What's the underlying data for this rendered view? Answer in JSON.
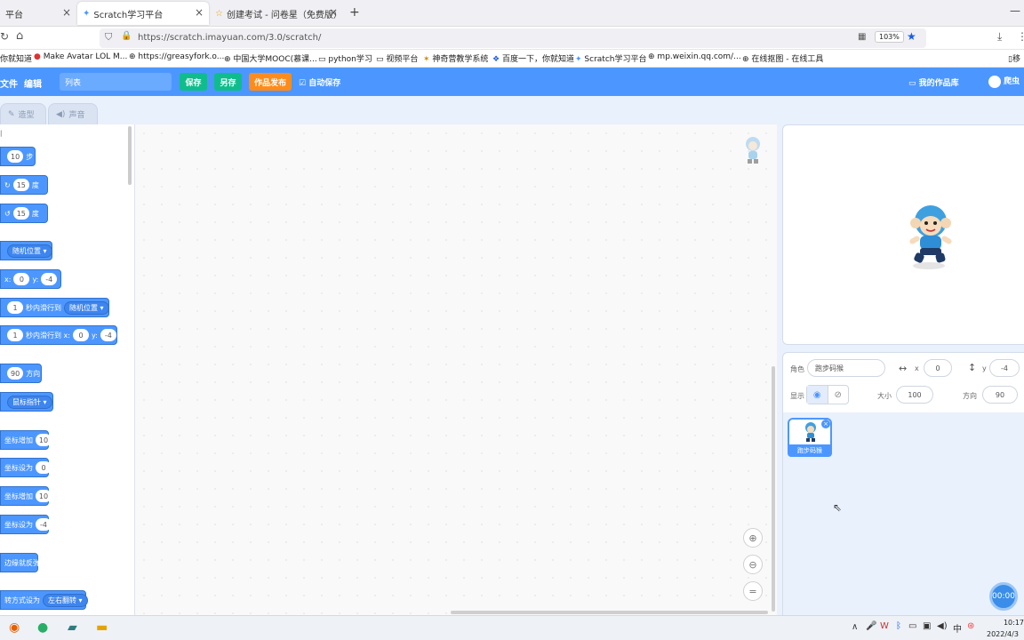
{
  "browser": {
    "tabs": [
      {
        "label": "平台"
      },
      {
        "label": "Scratch学习平台"
      },
      {
        "label": "创建考试 - 问卷星（免费版）"
      }
    ],
    "url": "https://scratch.imayuan.com/3.0/scratch/",
    "zoom": "103%",
    "bookmarks": [
      "你就知道",
      "Make Avatar LOL M...",
      "https://greasyfork.o...",
      "中国大学MOOC(慕课...",
      "python学习",
      "视频平台",
      "神奇营教学系统",
      "百度一下，你就知道",
      "Scratch学习平台",
      "mp.weixin.qq.com/...",
      "在线抠图 - 在线工具",
      "移"
    ]
  },
  "menubar": {
    "file": "文件",
    "edit": "编辑",
    "title_value": "列表",
    "save": "保存",
    "save_as": "另存",
    "publish": "作品发布",
    "autosave": "自动保存",
    "my_works": "我的作品库",
    "user": "爬虫"
  },
  "editor_tabs": {
    "costumes": "造型",
    "sounds": "声音"
  },
  "palette": {
    "move": {
      "steps": "10",
      "unit": "步"
    },
    "turn_right": {
      "deg": "15",
      "unit": "度"
    },
    "turn_left": {
      "deg": "15",
      "unit": "度"
    },
    "goto": {
      "target": "随机位置"
    },
    "goto_xy": {
      "x_label": "x:",
      "x": "0",
      "y_label": "y:",
      "y": "-4"
    },
    "glide_to": {
      "secs": "1",
      "text": "秒内滑行到",
      "target": "随机位置"
    },
    "glide_xy": {
      "secs": "1",
      "text": "秒内滑行到 x:",
      "x": "0",
      "y_label": "y:",
      "y": "-4"
    },
    "point_dir": {
      "dir": "90",
      "text": "方向"
    },
    "point_towards": {
      "target": "鼠标指针"
    },
    "change_x": {
      "text": "坐标增加",
      "value": "10"
    },
    "set_x": {
      "text": "坐标设为",
      "value": "0"
    },
    "change_y": {
      "text": "坐标增加",
      "value": "10"
    },
    "set_y": {
      "text": "坐标设为",
      "value": "-4"
    },
    "bounce": {
      "text": "边缘就反弹"
    },
    "rotation": {
      "text": "转方式设为",
      "value": "左右翻转"
    }
  },
  "sprite_info": {
    "sprite_label": "角色",
    "sprite_name": "跑步码猴",
    "x_label": "x",
    "x": "0",
    "y_label": "y",
    "y": "-4",
    "show_label": "显示",
    "size_label": "大小",
    "size": "100",
    "dir_label": "方向",
    "dir": "90"
  },
  "sprite_list": [
    {
      "name": "跑步码猴"
    }
  ],
  "timer": "00:00",
  "taskbar": {
    "time": "10:17",
    "date": "2022/4/3"
  }
}
